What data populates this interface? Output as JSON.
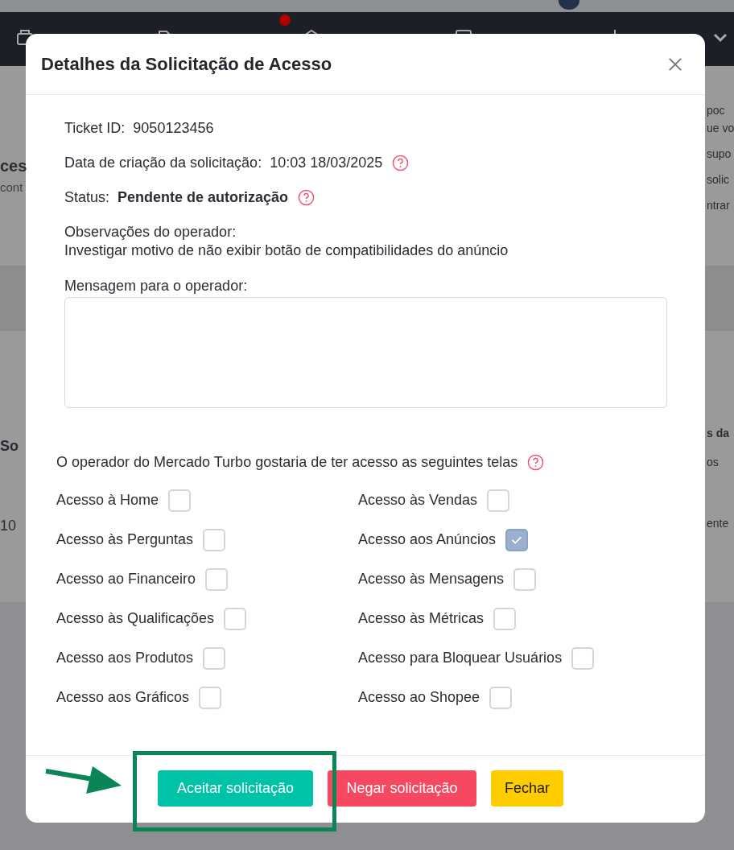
{
  "background": {
    "left_fragments": [
      {
        "text": "ces",
        "kind": "title"
      },
      {
        "text": "cont",
        "kind": "subtitle"
      },
      {
        "text": "So",
        "kind": "header"
      },
      {
        "text": "10",
        "kind": "cell"
      }
    ],
    "right_fragments": [
      {
        "text": "poc",
        "kind": "line"
      },
      {
        "text": "ue vo",
        "kind": "line"
      },
      {
        "text": "supo",
        "kind": "line"
      },
      {
        "text": "solic",
        "kind": "line"
      },
      {
        "text": "ntrar",
        "kind": "line"
      },
      {
        "text": "s da",
        "kind": "header"
      },
      {
        "text": "os",
        "kind": "cell"
      },
      {
        "text": "ente",
        "kind": "cell"
      }
    ]
  },
  "modal": {
    "title": "Detalhes da Solicitação de Acesso",
    "ticket": {
      "label": "Ticket ID:",
      "value": "9050123456"
    },
    "created": {
      "label": "Data de criação da solicitação:",
      "value": "10:03 18/03/2025"
    },
    "status": {
      "label": "Status:",
      "value": "Pendente de autorização"
    },
    "observations": {
      "label": "Observações do operador:",
      "value": "Investigar motivo de não exibir botão de compatibilidades do anúncio"
    },
    "message": {
      "label": "Mensagem para o operador:"
    },
    "permissions": {
      "heading": "O operador do Mercado Turbo gostaria de ter acesso as seguintes telas",
      "items": [
        {
          "label": "Acesso à Home",
          "checked": false
        },
        {
          "label": "Acesso às Vendas",
          "checked": false
        },
        {
          "label": "Acesso às Perguntas",
          "checked": false
        },
        {
          "label": "Acesso aos Anúncios",
          "checked": true
        },
        {
          "label": "Acesso ao Financeiro",
          "checked": false
        },
        {
          "label": "Acesso às Mensagens",
          "checked": false
        },
        {
          "label": "Acesso às Qualificações",
          "checked": false
        },
        {
          "label": "Acesso às Métricas",
          "checked": false
        },
        {
          "label": "Acesso aos Produtos",
          "checked": false
        },
        {
          "label": "Acesso para Bloquear Usuários",
          "checked": false
        },
        {
          "label": "Acesso aos Gráficos",
          "checked": false
        },
        {
          "label": "Acesso ao Shopee",
          "checked": false
        }
      ]
    },
    "buttons": [
      {
        "label": "Aceitar solicitação",
        "kind": "accept"
      },
      {
        "label": "Negar solicitação",
        "kind": "deny"
      },
      {
        "label": "Fechar",
        "kind": "close"
      }
    ]
  }
}
